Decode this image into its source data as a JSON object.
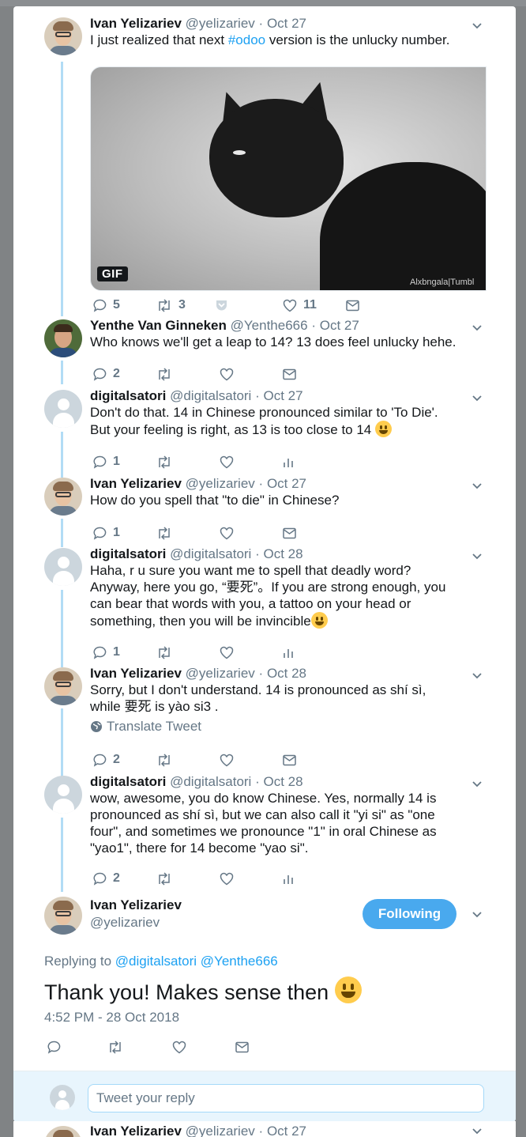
{
  "tweets": [
    {
      "name": "Ivan Yelizariev",
      "handle": "@yelizariev",
      "date": "Oct 27",
      "avatar": "ivan",
      "text_parts": [
        "I just realized that next ",
        "#odoo",
        " version is the unlucky number."
      ],
      "media": {
        "badge": "GIF",
        "watermark": "Alxbngala|Tumbl"
      },
      "replies": "5",
      "retweets": "3",
      "likes": "11"
    },
    {
      "name": "Yenthe Van Ginneken",
      "handle": "@Yenthe666",
      "date": "Oct 27",
      "avatar": "yenthe",
      "text": "Who knows we'll get a leap to 14? 13 does feel unlucky hehe.",
      "replies": "2"
    },
    {
      "name": "digitalsatori",
      "handle": "@digitalsatori",
      "date": "Oct 27",
      "avatar": "egg",
      "text_line1": "Don't do that. 14 in Chinese pronounced similar to 'To Die'.",
      "text_line2": "But your feeling is right, as 13 is too close to 14",
      "replies": "1"
    },
    {
      "name": "Ivan Yelizariev",
      "handle": "@yelizariev",
      "date": "Oct 27",
      "avatar": "ivan",
      "text": "How do you spell that \"to die\" in Chinese?",
      "replies": "1"
    },
    {
      "name": "digitalsatori",
      "handle": "@digitalsatori",
      "date": "Oct 28",
      "avatar": "egg",
      "text_line1": "Haha, r u sure you want me to spell that deadly word?",
      "text_line2": "Anyway, here you go, “要死”。If you are strong enough, you",
      "text_line3": "can bear that words with you, a tattoo on your head or",
      "text_line4": "something, then you will be invincible",
      "replies": "1"
    },
    {
      "name": "Ivan Yelizariev",
      "handle": "@yelizariev",
      "date": "Oct 28",
      "avatar": "ivan",
      "text_line1": "Sorry, but I don't understand. 14 is pronounced as shí sì,",
      "text_line2": "while 要死 is yào si3 .",
      "translate": "Translate Tweet",
      "replies": "2"
    },
    {
      "name": "digitalsatori",
      "handle": "@digitalsatori",
      "date": "Oct 28",
      "avatar": "egg",
      "text_line1": "wow, awesome, you do know Chinese. Yes, normally 14 is",
      "text_line2": "pronounced as shí sì, but we can also call it \"yi si\" as \"one",
      "text_line3": "four\", and sometimes we pronounce \"1\" in oral Chinese as",
      "text_line4": "\"yao1\", there for 14 become \"yao si\".",
      "replies": "2"
    }
  ],
  "main_tweet": {
    "name": "Ivan Yelizariev",
    "handle": "@yelizariev",
    "follow_label": "Following",
    "replying_prefix": "Replying to",
    "mention1": "@digitalsatori",
    "mention2": "@Yenthe666",
    "text": "Thank you! Makes sense then",
    "timestamp": "4:52 PM - 28 Oct 2018"
  },
  "reply_box": {
    "placeholder": "Tweet your reply"
  },
  "next_tweet": {
    "name": "Ivan Yelizariev",
    "handle": "@yelizariev",
    "date": "Oct 27"
  },
  "separator": "·",
  "colors": {
    "accent": "#1da1f2",
    "follow_button": "#49a9ee",
    "thread_line": "#b2dcf5",
    "muted": "#657786"
  }
}
